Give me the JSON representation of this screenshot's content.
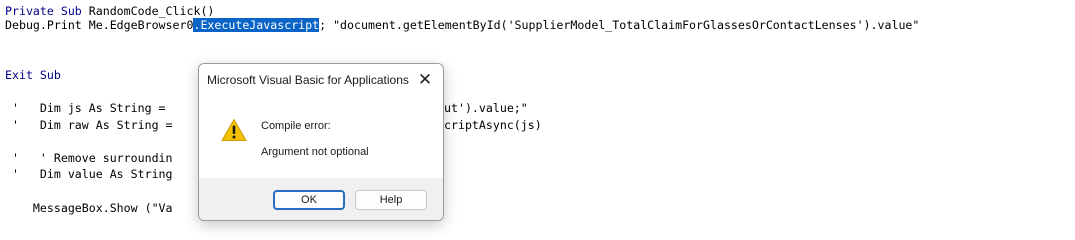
{
  "code": {
    "line1_kw": "Private Sub",
    "line1_rest": " RandomCode_Click()",
    "line2_pre": "Debug.Print Me.EdgeBrowser0",
    "line2_sel": ".ExecuteJavascript",
    "line2_post": "; \"document.getElementById('SupplierModel_TotalClaimForGlassesOrContactLenses').value\"",
    "line3_kw": "Exit Sub",
    "line4_left": " '   Dim js As String = ",
    "line4_right": "ut').value;\"",
    "line5_left": " '   Dim raw As String = ",
    "line5_right": "criptAsync(js)",
    "line6_left": " '   ' Remove surroundin",
    "line7_left": " '   Dim value As String",
    "line8_left": "    MessageBox.Show (\"Va"
  },
  "dialog": {
    "title": "Microsoft Visual Basic for Applications",
    "close_glyph": "✕",
    "message_line1": "Compile error:",
    "message_line2": "Argument not optional",
    "ok_label": "OK",
    "help_label": "Help",
    "icon": "warning-icon"
  },
  "colors": {
    "selection": "#0a64c8",
    "keyword": "#00008b",
    "comment": "#007a00",
    "warning": "#f2c200",
    "ok_border": "#2a6cc0"
  }
}
